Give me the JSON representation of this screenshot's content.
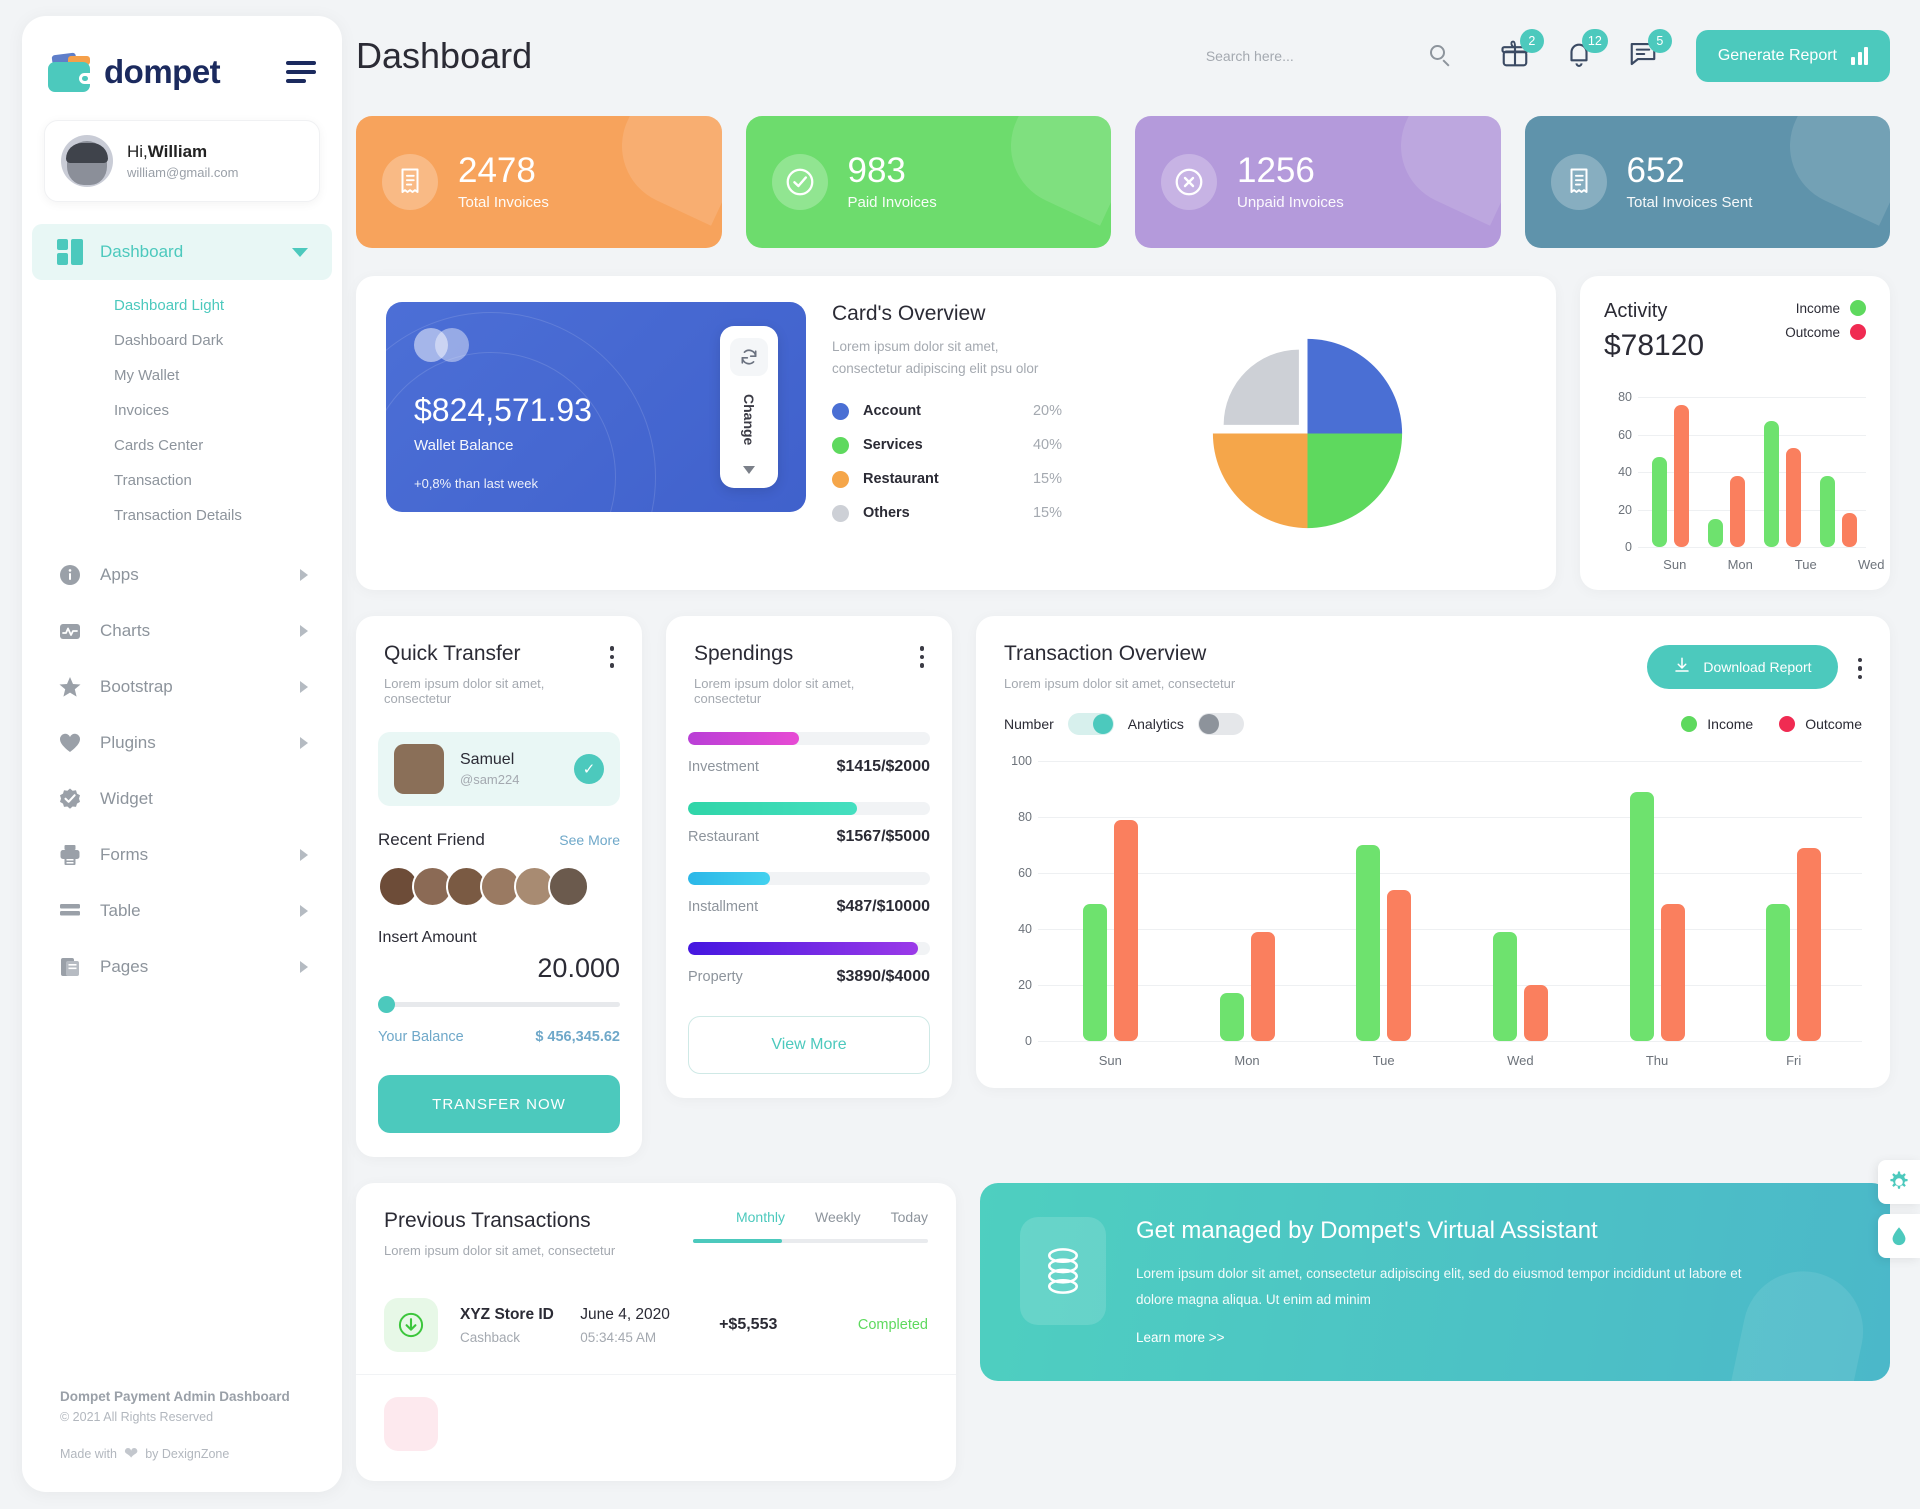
{
  "brand": {
    "name": "dompet"
  },
  "profile": {
    "greeting": "Hi,",
    "name": "William",
    "email": "william@gmail.com"
  },
  "sidebar": {
    "dashboard_label": "Dashboard",
    "submenu": [
      {
        "label": "Dashboard Light",
        "active": true
      },
      {
        "label": "Dashboard Dark",
        "active": false
      },
      {
        "label": "My Wallet",
        "active": false
      },
      {
        "label": "Invoices",
        "active": false
      },
      {
        "label": "Cards Center",
        "active": false
      },
      {
        "label": "Transaction",
        "active": false
      },
      {
        "label": "Transaction Details",
        "active": false
      }
    ],
    "items": [
      {
        "label": "Apps"
      },
      {
        "label": "Charts"
      },
      {
        "label": "Bootstrap"
      },
      {
        "label": "Plugins"
      },
      {
        "label": "Widget"
      },
      {
        "label": "Forms"
      },
      {
        "label": "Table"
      },
      {
        "label": "Pages"
      }
    ],
    "footer": {
      "line1": "Dompet Payment Admin Dashboard",
      "line2": "© 2021 All Rights Reserved",
      "made_prefix": "Made with",
      "made_suffix": "by DexignZone"
    }
  },
  "header": {
    "title": "Dashboard",
    "search_placeholder": "Search here...",
    "gift_badge": "2",
    "bell_badge": "12",
    "message_badge": "5",
    "generate_report": "Generate Report"
  },
  "stats": [
    {
      "value": "2478",
      "label": "Total Invoices",
      "color": "#f7a35c",
      "icon": "invoice-icon"
    },
    {
      "value": "983",
      "label": "Paid Invoices",
      "color": "#6ddc6d",
      "icon": "check-circle-icon"
    },
    {
      "value": "1256",
      "label": "Unpaid Invoices",
      "color": "#b49adb",
      "icon": "x-circle-icon"
    },
    {
      "value": "652",
      "label": "Total Invoices Sent",
      "color": "#5f93ab",
      "icon": "invoice-icon"
    }
  ],
  "wallet_card": {
    "amount": "$824,571.93",
    "label": "Wallet Balance",
    "note": "+0,8% than last week",
    "change_label": "Change"
  },
  "cards_overview": {
    "title": "Card's Overview",
    "subtitle": "Lorem ipsum dolor sit amet, consectetur adipiscing elit psu olor",
    "chart_data": {
      "type": "pie",
      "title": "Card's Overview",
      "categories": [
        "Account",
        "Services",
        "Restaurant",
        "Others"
      ],
      "values": [
        20,
        40,
        15,
        15
      ],
      "labels": [
        "20%",
        "40%",
        "15%",
        "15%"
      ],
      "colors": [
        "#4a6fd4",
        "#5ed95e",
        "#f5a64a",
        "#cdd0d6"
      ],
      "legend": "right"
    }
  },
  "activity": {
    "title": "Activity",
    "amount": "$78120",
    "income_label": "Income",
    "outcome_label": "Outcome",
    "chart_data": {
      "type": "bar",
      "title": "Activity",
      "categories": [
        "Sun",
        "Mon",
        "Tue",
        "Wed"
      ],
      "series": [
        {
          "name": "Income",
          "values": [
            48,
            15,
            67,
            38
          ],
          "color": "#6ee26e"
        },
        {
          "name": "Outcome",
          "values": [
            76,
            38,
            53,
            18
          ],
          "color": "#fa7f5e"
        }
      ],
      "yticks": [
        0,
        20,
        40,
        60,
        80
      ],
      "ylim": [
        0,
        80
      ],
      "grid": true,
      "legend": "top-right"
    }
  },
  "quick_transfer": {
    "title": "Quick Transfer",
    "subtitle": "Lorem ipsum dolor sit amet, consectetur",
    "selected": {
      "name": "Samuel",
      "handle": "@sam224"
    },
    "recent_friend": "Recent Friend",
    "see_more": "See More",
    "insert_amount_label": "Insert Amount",
    "amount_value": "20.000",
    "balance_label": "Your Balance",
    "balance_value": "$ 456,345.62",
    "transfer_button": "TRANSFER NOW",
    "friend_colors": [
      "#6d4c38",
      "#8b6a55",
      "#7a5a43",
      "#9a7a62",
      "#a88b72",
      "#6b5a4d"
    ]
  },
  "spendings": {
    "title": "Spendings",
    "subtitle": "Lorem ipsum dolor sit amet, consectetur",
    "view_more": "View More",
    "items": [
      {
        "name": "Investment",
        "amount": "$1415",
        "max": "/$2000",
        "pct": 46,
        "from": "#b93fd6",
        "to": "#e74bd4"
      },
      {
        "name": "Restaurant",
        "amount": "$1567",
        "max": "/$5000",
        "pct": 70,
        "from": "#2fd5a8",
        "to": "#45dfc0"
      },
      {
        "name": "Installment",
        "amount": "$487",
        "max": "/$10000",
        "pct": 34,
        "from": "#2bb7e8",
        "to": "#43d1ef"
      },
      {
        "name": "Property",
        "amount": "$3890",
        "max": "/$4000",
        "pct": 95,
        "from": "#4416e0",
        "to": "#9b3ae8"
      }
    ]
  },
  "transaction_overview": {
    "title": "Transaction Overview",
    "subtitle": "Lorem ipsum dolor sit amet, consectetur",
    "download_label": "Download Report",
    "toggle_number_label": "Number",
    "toggle_analytics_label": "Analytics",
    "income_label": "Income",
    "outcome_label": "Outcome",
    "chart_data": {
      "type": "bar",
      "title": "Transaction Overview",
      "categories": [
        "Sun",
        "Mon",
        "Tue",
        "Wed",
        "Thu",
        "Fri"
      ],
      "series": [
        {
          "name": "Income",
          "values": [
            49,
            17,
            70,
            39,
            89,
            49
          ],
          "color": "#6ee26e"
        },
        {
          "name": "Outcome",
          "values": [
            79,
            39,
            54,
            20,
            49,
            69
          ],
          "color": "#fa7f5e"
        }
      ],
      "yticks": [
        0,
        20,
        40,
        60,
        80,
        100
      ],
      "ylim": [
        0,
        100
      ],
      "grid": true,
      "legend": "top-right"
    }
  },
  "previous_transactions": {
    "title": "Previous Transactions",
    "subtitle": "Lorem ipsum dolor sit amet, consectetur",
    "tabs": [
      {
        "label": "Monthly",
        "active": true
      },
      {
        "label": "Weekly",
        "active": false
      },
      {
        "label": "Today",
        "active": false
      }
    ],
    "rows": [
      {
        "name": "XYZ Store ID",
        "type": "Cashback",
        "date": "June 4, 2020",
        "time": "05:34:45 AM",
        "amount": "+$5,553",
        "status": "Completed",
        "status_color": "#5ed95e",
        "icon": "arrow-down-circle-icon",
        "icon_bg": "#e7f8e7",
        "icon_color": "#3cc63c"
      }
    ]
  },
  "promo": {
    "title": "Get managed by Dompet's Virtual Assistant",
    "text": "Lorem ipsum dolor sit amet, consectetur adipiscing elit, sed do eiusmod tempor incididunt ut labore et dolore magna aliqua. Ut enim ad minim",
    "link": "Learn more >>"
  },
  "colors": {
    "accent": "#4cc9bd",
    "income": "#6ee26e",
    "outcome": "#fa7f5e",
    "brand_dark": "#1b2a5e"
  }
}
